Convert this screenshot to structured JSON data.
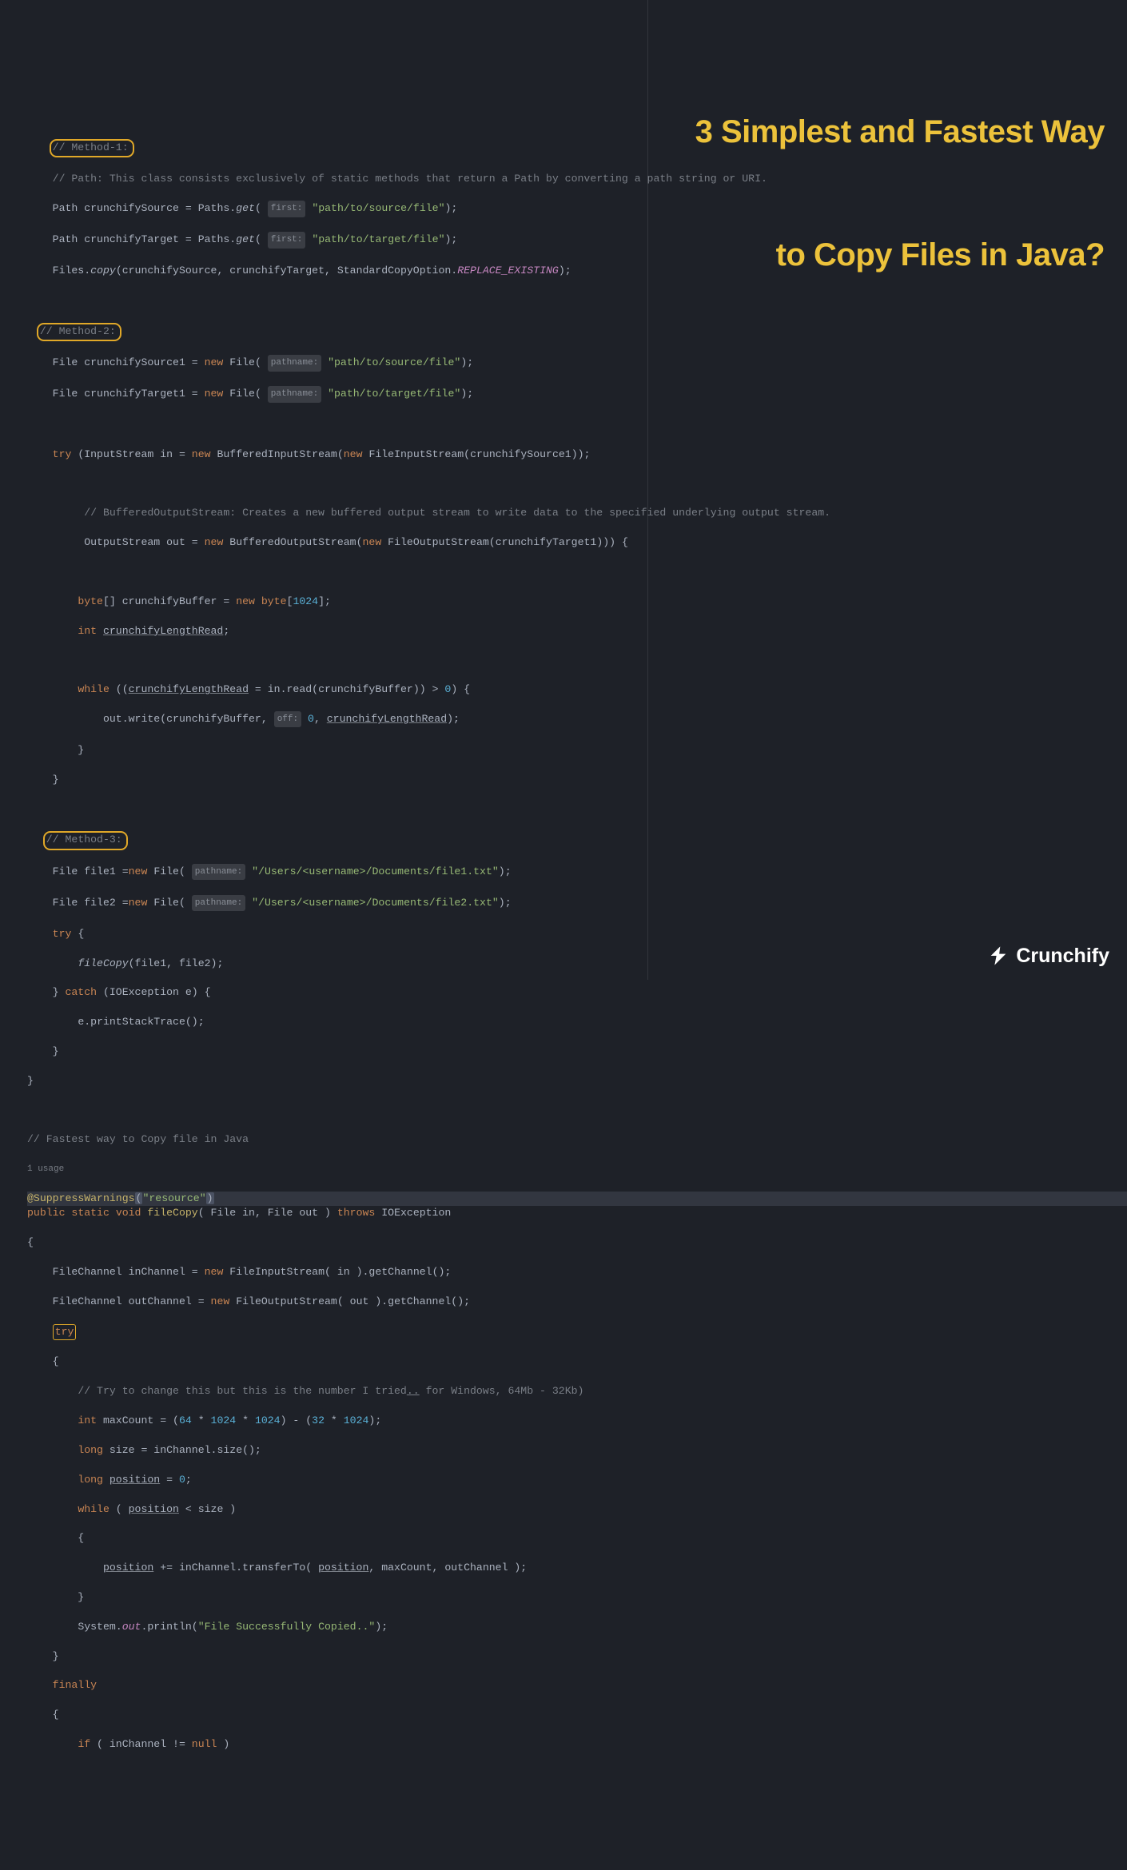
{
  "title": {
    "line1": "3 Simplest and Fastest Way",
    "line2": "to Copy Files in Java?"
  },
  "logo": "Crunchify",
  "c": {
    "m1": "// Method-1:",
    "m1desc": "// Path: This class consists exclusively of static methods that return a Path by converting a path string or URI.",
    "m2": "// Method-2:",
    "m3": "// Method-3:",
    "bufout": "// BufferedOutputStream: Creates a new buffered output stream to write data to the specified underlying output stream.",
    "fastest": "// Fastest way to Copy file in Java",
    "trychange": "// Try to change this but this is the number I tried",
    "trychange2": " for Windows, 64Mb - 32Kb)"
  },
  "s": {
    "src": "\"path/to/source/file\"",
    "tgt": "\"path/to/target/file\"",
    "f1": "\"/Users/<username>/Documents/file1.txt\"",
    "f2": "\"/Users/<username>/Documents/file2.txt\"",
    "resource": "\"resource\"",
    "copied": "\"File Successfully Copied..\""
  },
  "h": {
    "first": "first:",
    "pathname": "pathname:",
    "off": "off:"
  },
  "u": {
    "usage": "1 usage"
  },
  "n": {
    "n1024": "1024",
    "n64": "64",
    "n32": "32",
    "n0": "0"
  },
  "k": {
    "new": "new",
    "try": "try",
    "catch": "catch",
    "public": "public",
    "static": "static",
    "void": "void",
    "throws": "throws",
    "int": "int",
    "byte": "byte",
    "while": "while",
    "long": "long",
    "finally": "finally",
    "if": "if",
    "null": "null"
  },
  "id": {
    "Path": "Path",
    "Paths": "Paths",
    "Files": "Files",
    "crunchifySource": "crunchifySource",
    "crunchifyTarget": "crunchifyTarget",
    "get": "get",
    "copy": "copy",
    "StandardCopyOption": "StandardCopyOption",
    "REPLACE_EXISTING": "REPLACE_EXISTING",
    "File": "File",
    "crunchifySource1": "crunchifySource1",
    "crunchifyTarget1": "crunchifyTarget1",
    "InputStream": "InputStream",
    "in": "in",
    "BufferedInputStream": "BufferedInputStream",
    "FileInputStream": "FileInputStream",
    "OutputStream": "OutputStream",
    "out": "out",
    "BufferedOutputStream": "BufferedOutputStream",
    "FileOutputStream": "FileOutputStream",
    "crunchifyBuffer": "crunchifyBuffer",
    "crunchifyLengthRead": "crunchifyLengthRead",
    "read": "read",
    "write": "write",
    "file1": "file1",
    "file2": "file2",
    "fileCopy": "fileCopy",
    "IOException": "IOException",
    "e": "e",
    "printStackTrace": "printStackTrace",
    "SuppressWarnings": "SuppressWarnings",
    "FileChannel": "FileChannel",
    "inChannel": "inChannel",
    "outChannel": "outChannel",
    "getChannel": "getChannel",
    "maxCount": "maxCount",
    "size": "size",
    "position": "position",
    "transferTo": "transferTo",
    "System": "System",
    "println": "println"
  }
}
